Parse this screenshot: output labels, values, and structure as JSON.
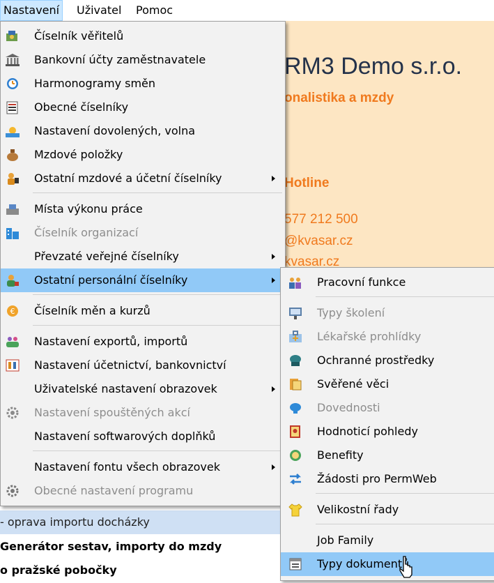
{
  "menubar": {
    "items": [
      "Nastavení",
      "Uživatel",
      "Pomoc"
    ]
  },
  "background": {
    "company": "RM3 Demo s.r.o.",
    "subtitle": "onalistika a mzdy",
    "hotline": "Hotline",
    "phone": "577 212 500",
    "email": "@kvasar.cz",
    "web": "kvasar.cz",
    "rows": [
      "- oprava importu docházky",
      "Generátor sestav, importy do mzdy",
      "o pražské pobočky"
    ]
  },
  "main_menu": {
    "items": [
      {
        "label": "Číselník věřitelů",
        "icon": "creditors-icon"
      },
      {
        "label": "Bankovní účty zaměstnavatele",
        "icon": "bank-icon"
      },
      {
        "label": "Harmonogramy směn",
        "icon": "shift-schedule-icon"
      },
      {
        "label": "Obecné číselníky",
        "icon": "general-codelist-icon"
      },
      {
        "label": "Nastavení dovolených, volna",
        "icon": "vacation-icon"
      },
      {
        "label": "Mzdové položky",
        "icon": "money-bag-icon"
      },
      {
        "label": "Ostatní mzdové a účetní číselníky",
        "icon": "payroll-codelist-icon"
      },
      {
        "label": "Místa výkonu práce",
        "icon": "workplace-icon"
      },
      {
        "label": "Číselník organizací",
        "icon": "organization-icon"
      },
      {
        "label": "Převzaté veřejné číselníky",
        "icon": ""
      },
      {
        "label": "Ostatní personální číselníky",
        "icon": "personnel-icon"
      },
      {
        "label": "Číselník měn a kurzů",
        "icon": "currency-icon"
      },
      {
        "label": "Nastavení exportů, importů",
        "icon": "export-import-icon"
      },
      {
        "label": "Nastavení účetnictví, bankovnictví",
        "icon": "accounting-icon"
      },
      {
        "label": "Uživatelské nastavení obrazovek",
        "icon": ""
      },
      {
        "label": "Nastavení spouštěných akcí",
        "icon": "actions-gear-icon"
      },
      {
        "label": "Nastavení softwarových doplňků",
        "icon": ""
      },
      {
        "label": "Nastavení fontu všech obrazovek",
        "icon": ""
      },
      {
        "label": "Obecné nastavení programu",
        "icon": "settings-gear-icon"
      }
    ]
  },
  "submenu": {
    "items": [
      {
        "label": "Pracovní funkce",
        "icon": "job-functions-icon"
      },
      {
        "label": "Typy školení",
        "icon": "training-icon"
      },
      {
        "label": "Lékařské prohlídky",
        "icon": "medical-kit-icon"
      },
      {
        "label": "Ochranné prostředky",
        "icon": "protective-gear-icon"
      },
      {
        "label": "Svěřené věci",
        "icon": "entrusted-items-icon"
      },
      {
        "label": "Dovednosti",
        "icon": "skills-icon"
      },
      {
        "label": "Hodnoticí pohledy",
        "icon": "evaluation-icon"
      },
      {
        "label": "Benefity",
        "icon": "benefits-icon"
      },
      {
        "label": "Žádosti pro PermWeb",
        "icon": "exchange-arrows-icon"
      },
      {
        "label": "Velikostní řady",
        "icon": "shirt-icon"
      },
      {
        "label": "Job Family",
        "icon": ""
      },
      {
        "label": "Typy dokumentů",
        "icon": "document-types-icon"
      }
    ]
  },
  "colors": {
    "highlight": "#91c9f7",
    "accent": "#f07a1e",
    "menubar_active": "#cce8ff"
  }
}
